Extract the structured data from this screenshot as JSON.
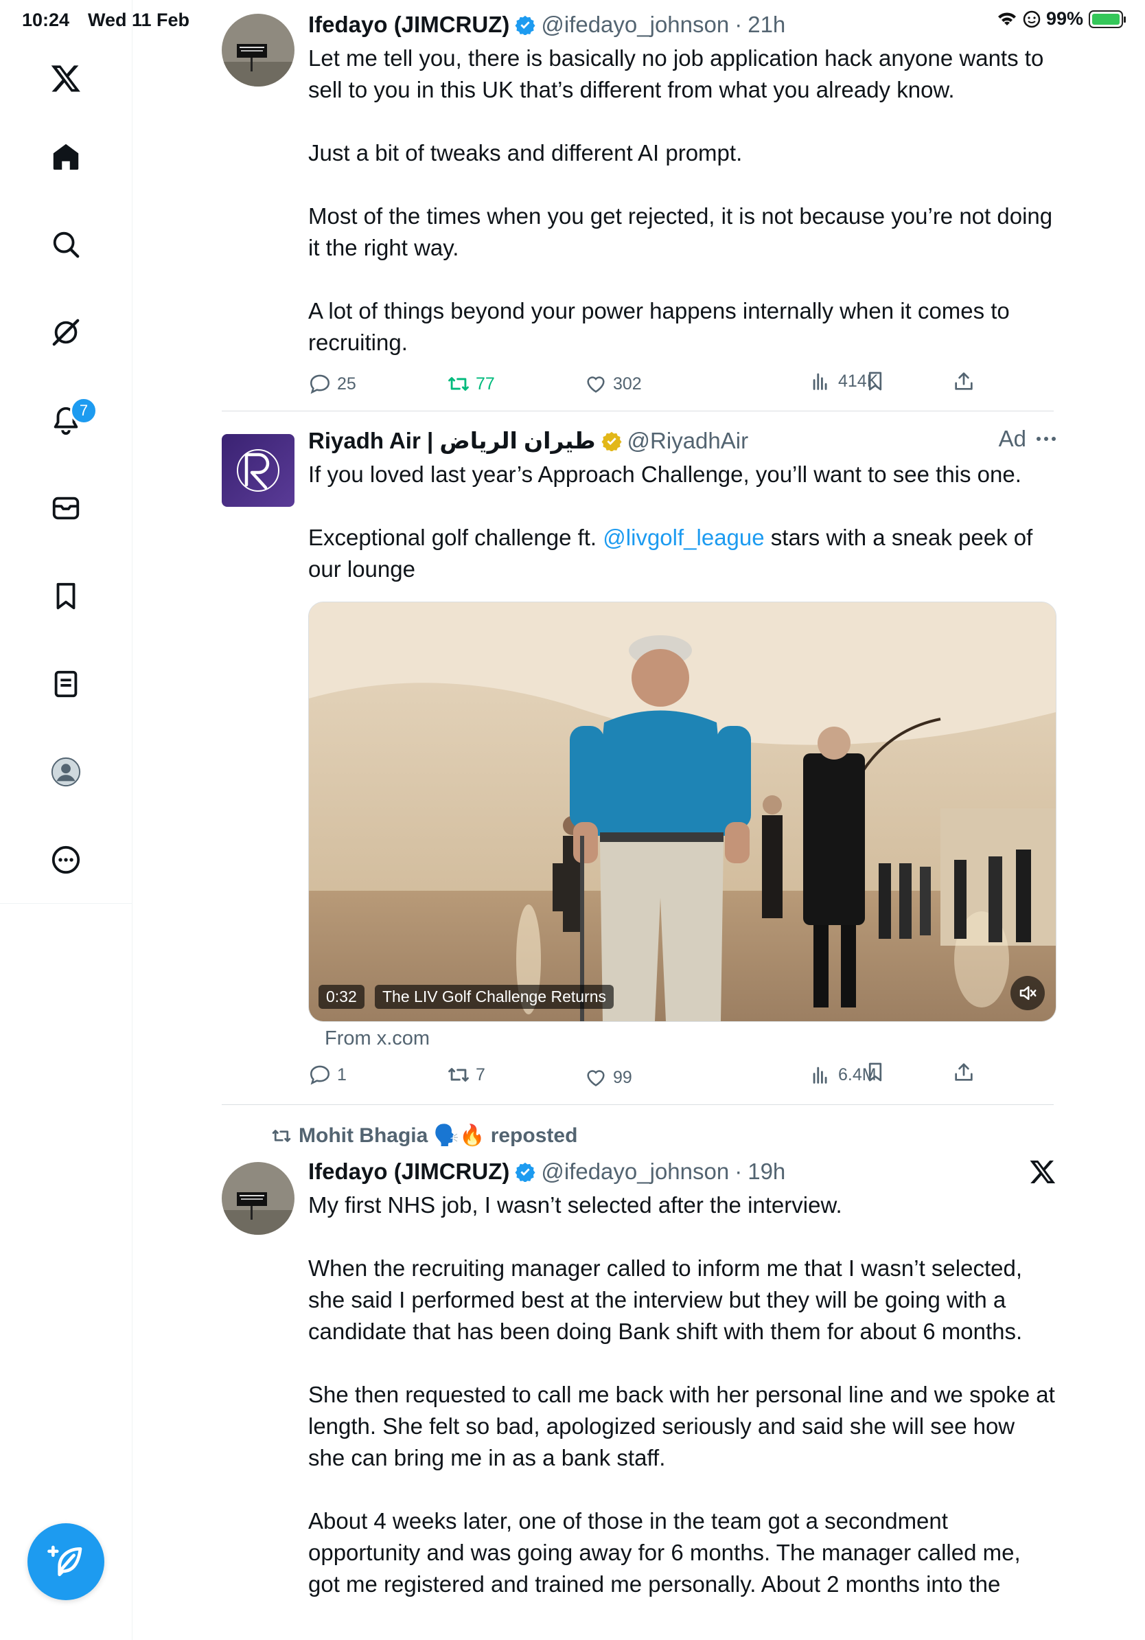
{
  "status_bar": {
    "time": "10:24",
    "date": "Wed 11 Feb",
    "battery": "99%",
    "battery_level": 0.99
  },
  "sidebar": {
    "notifications_badge": "7",
    "items": [
      "x-logo-icon",
      "home-icon",
      "search-icon",
      "grok-icon",
      "notifications-icon",
      "messages-icon",
      "bookmarks-icon",
      "lists-icon",
      "profile-icon",
      "more-icon"
    ]
  },
  "tweets": [
    {
      "name": "Ifedayo (JIMCRUZ)",
      "handle": "@ifedayo_johnson",
      "time": "21h",
      "paragraphs": [
        "Let me tell you, there is basically no job application hack anyone wants to sell to you in this UK that’s different from what you already know.",
        "Just a bit of tweaks and different AI prompt.",
        "Most of the times when you get rejected, it is not because you’re not doing it the right way.",
        "A lot of things beyond your power happens internally when it comes to recruiting."
      ],
      "replies": "25",
      "reposts": "77",
      "likes": "302",
      "views": "414K"
    },
    {
      "name": "Riyadh Air | طيران الرياض",
      "handle": "@RiyadhAir",
      "ad_label": "Ad",
      "paragraph1": "If you loved last year’s Approach Challenge, you’ll want to see this one.",
      "paragraph2_before": "Exceptional golf challenge ft. ",
      "paragraph2_link": "@livgolf_league",
      "paragraph2_after": " stars with a sneak peek of our lounge",
      "video_duration": "0:32",
      "video_title": "The LIV Golf Challenge Returns",
      "source": "From x.com",
      "replies": "1",
      "reposts": "7",
      "likes": "99",
      "views": "6.4M"
    },
    {
      "reposted_by": "Mohit Bhagia 🗣️🔥 reposted",
      "name": "Ifedayo (JIMCRUZ)",
      "handle": "@ifedayo_johnson",
      "time": "19h",
      "paragraphs": [
        "My first NHS job, I wasn’t selected after the interview.",
        "When the recruiting manager called to inform me that I wasn’t selected, she said I performed best at the interview but they will be going with a candidate that has been doing Bank shift with them for about 6 months.",
        "She then requested to call me back with her personal line and we spoke at length. She felt so bad, apologized seriously and said she will see how she can bring me in as a bank staff.",
        "About 4 weeks later, one of those in the team got a secondment opportunity and was going away for 6 months. The manager called me, got me registered and trained me personally. About 2 months into the"
      ]
    }
  ],
  "colors": {
    "accent": "#1d9bf0",
    "repost_active": "#00ba7c",
    "secondary_text": "#536471",
    "gold_verified": "#e2b719"
  }
}
